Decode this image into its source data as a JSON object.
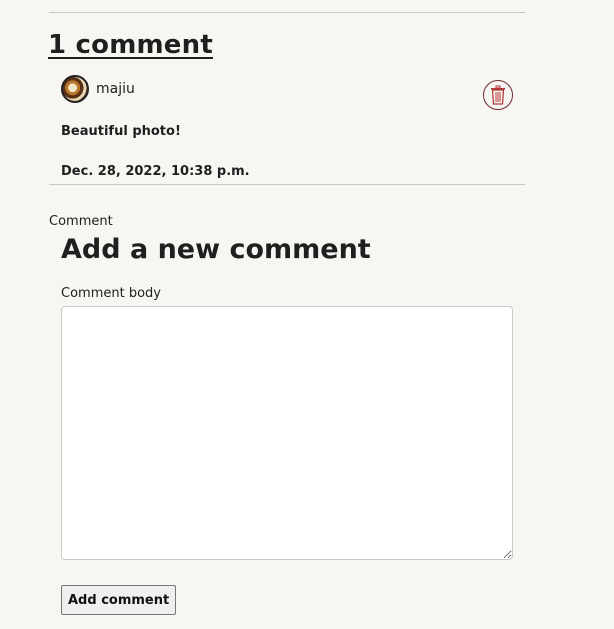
{
  "comments": {
    "heading": "1 comment",
    "items": [
      {
        "username": "majiu",
        "body": "Beautiful photo!",
        "date": "Dec. 28, 2022, 10:38 p.m.",
        "avatar_icon": "user-avatar-photo",
        "delete_icon": "trash-icon"
      }
    ]
  },
  "form": {
    "section_label": "Comment",
    "title": "Add a new comment",
    "body_label": "Comment body",
    "body_value": "",
    "submit_label": "Add comment"
  },
  "colors": {
    "background": "#f7f6f2",
    "text": "#1f1f1f",
    "delete_accent": "#6d2b2b"
  }
}
